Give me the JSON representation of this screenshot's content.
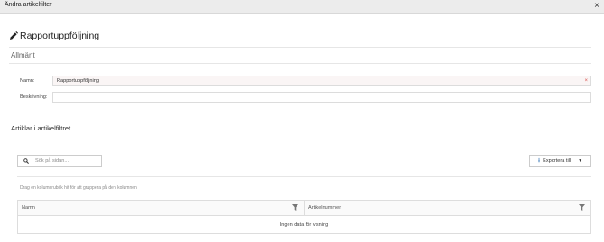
{
  "window": {
    "title": "Ändra artikelfilter",
    "close_glyph": "×"
  },
  "page": {
    "heading": "Rapportuppföljning",
    "heading_icon": "pencil-icon"
  },
  "general": {
    "section_title": "Allmänt",
    "name_label": "Namn:",
    "name_value": "Rapportuppföljning",
    "name_required_glyph": "×",
    "description_label": "Beskrivning:",
    "description_value": ""
  },
  "articles": {
    "section_title": "Artiklar i artikelfiltret",
    "search_placeholder": "Sök på sidan...",
    "export_label": "Exportera till",
    "group_hint": "Drag en kolumnrubrik hit för att gruppera på den kolumnen",
    "columns": [
      "Namn",
      "Artikelnummer"
    ],
    "empty_text": "Ingen data för visning"
  },
  "colors": {
    "accent": "#2c6fb3",
    "required": "#d9534f"
  }
}
